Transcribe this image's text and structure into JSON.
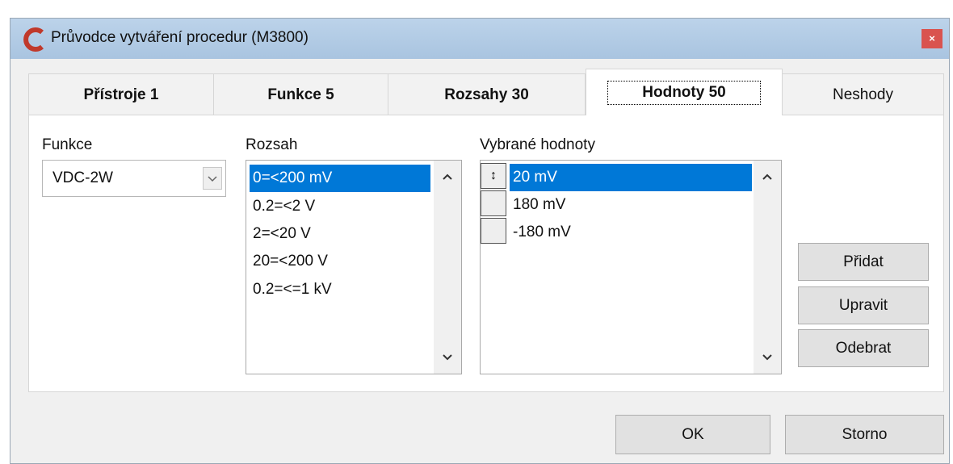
{
  "window": {
    "title": "Průvodce vytváření procedur (M3800)",
    "close_label": "×"
  },
  "tabs": [
    {
      "label": "Přístroje 1"
    },
    {
      "label": "Funkce 5"
    },
    {
      "label": "Rozsahy 30"
    },
    {
      "label": "Hodnoty 50"
    },
    {
      "label": "Neshody"
    }
  ],
  "function": {
    "label": "Funkce",
    "value": "VDC-2W"
  },
  "range": {
    "label": "Rozsah",
    "items": [
      "0=<200 mV",
      "0.2=<2 V",
      "2=<20 V",
      "20=<200 V",
      "0.2=<=1 kV"
    ],
    "selected_index": 0
  },
  "values": {
    "label": "Vybrané hodnoty",
    "items": [
      "20 mV",
      "180 mV",
      "-180 mV"
    ],
    "selected_index": 0,
    "selected_marker": "↕"
  },
  "buttons": {
    "add": "Přidat",
    "edit": "Upravit",
    "remove": "Odebrat",
    "ok": "OK",
    "cancel": "Storno"
  },
  "colors": {
    "selection": "#0078d7",
    "title_bar": "#b4cde6",
    "close_button": "#d9534f",
    "app_icon": "#c0392b"
  }
}
